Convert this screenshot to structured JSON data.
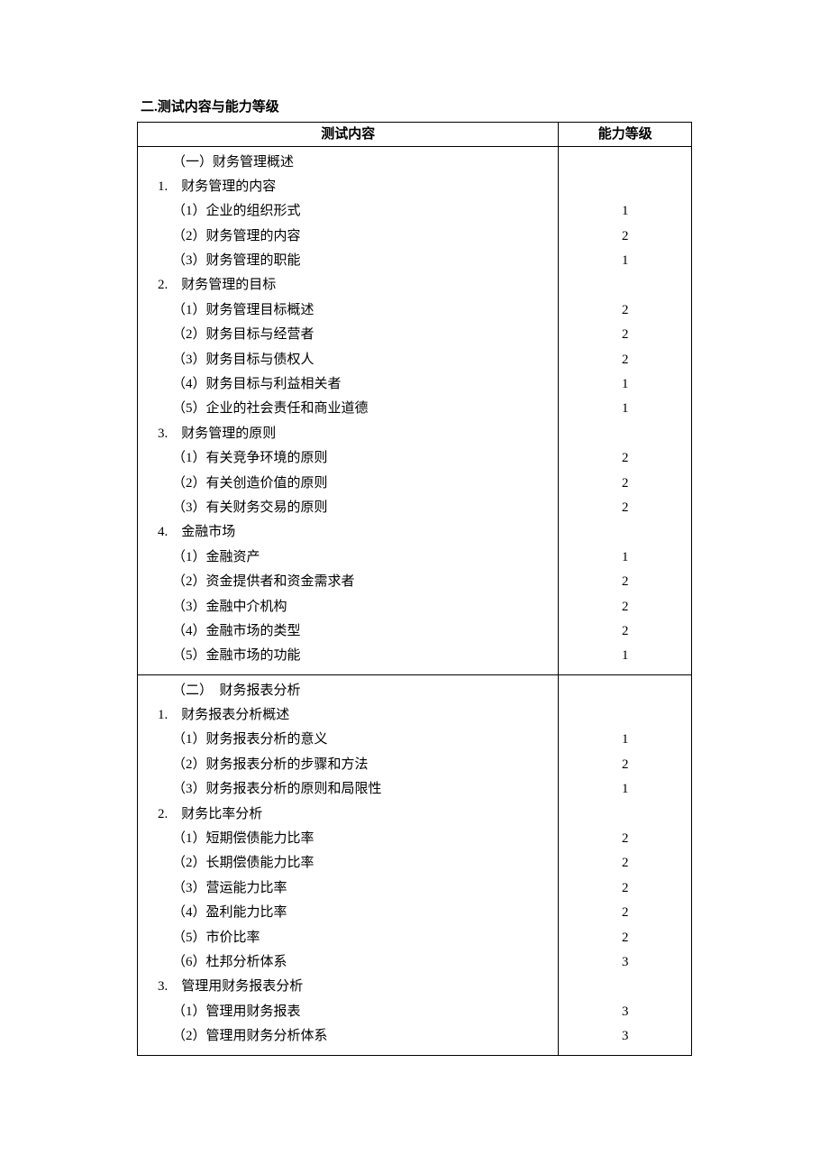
{
  "section_title": "二.测试内容与能力等级",
  "table": {
    "headers": {
      "content": "测试内容",
      "level": "能力等级"
    },
    "groups": [
      {
        "rows": [
          {
            "text": "（一）财务管理概述",
            "level": "",
            "cls": "heading-row"
          },
          {
            "text": "1.　财务管理的内容",
            "level": "",
            "cls": "num"
          },
          {
            "text": "（1）企业的组织形式",
            "level": "1",
            "cls": "sub-row"
          },
          {
            "text": "（2）财务管理的内容",
            "level": "2",
            "cls": "sub-row"
          },
          {
            "text": "（3）财务管理的职能",
            "level": "1",
            "cls": "sub-row"
          },
          {
            "text": "2.　财务管理的目标",
            "level": "",
            "cls": "num"
          },
          {
            "text": "（1）财务管理目标概述",
            "level": "2",
            "cls": "sub-row"
          },
          {
            "text": "（2）财务目标与经营者",
            "level": "2",
            "cls": "sub-row"
          },
          {
            "text": "（3）财务目标与债权人",
            "level": "2",
            "cls": "sub-row"
          },
          {
            "text": "（4）财务目标与利益相关者",
            "level": "1",
            "cls": "sub-row"
          },
          {
            "text": "（5）企业的社会责任和商业道德",
            "level": "1",
            "cls": "sub-row"
          },
          {
            "text": "3.　财务管理的原则",
            "level": "",
            "cls": "num"
          },
          {
            "text": "（1）有关竞争环境的原则",
            "level": "2",
            "cls": "sub-row"
          },
          {
            "text": "（2）有关创造价值的原则",
            "level": "2",
            "cls": "sub-row"
          },
          {
            "text": "（3）有关财务交易的原则",
            "level": "2",
            "cls": "sub-row"
          },
          {
            "text": "4.　金融市场",
            "level": "",
            "cls": "num"
          },
          {
            "text": "（1）金融资产",
            "level": "1",
            "cls": "sub-row"
          },
          {
            "text": "（2）资金提供者和资金需求者",
            "level": "2",
            "cls": "sub-row"
          },
          {
            "text": "（3）金融中介机构",
            "level": "2",
            "cls": "sub-row"
          },
          {
            "text": "（4）金融市场的类型",
            "level": "2",
            "cls": "sub-row"
          },
          {
            "text": "（5）金融市场的功能",
            "level": "1",
            "cls": "sub-row"
          }
        ]
      },
      {
        "rows": [
          {
            "text": "（二）　财务报表分析",
            "level": "",
            "cls": "heading-row"
          },
          {
            "text": "1.　财务报表分析概述",
            "level": "",
            "cls": "num"
          },
          {
            "text": "（1）财务报表分析的意义",
            "level": "1",
            "cls": "sub-row"
          },
          {
            "text": "（2）财务报表分析的步骤和方法",
            "level": "2",
            "cls": "sub-row"
          },
          {
            "text": "（3）财务报表分析的原则和局限性",
            "level": "1",
            "cls": "sub-row"
          },
          {
            "text": "2.　财务比率分析",
            "level": "",
            "cls": "num"
          },
          {
            "text": "（1）短期偿债能力比率",
            "level": "2",
            "cls": "sub-row"
          },
          {
            "text": "（2）长期偿债能力比率",
            "level": "2",
            "cls": "sub-row"
          },
          {
            "text": "（3）营运能力比率",
            "level": "2",
            "cls": "sub-row"
          },
          {
            "text": "（4）盈利能力比率",
            "level": "2",
            "cls": "sub-row"
          },
          {
            "text": "（5）市价比率",
            "level": "2",
            "cls": "sub-row"
          },
          {
            "text": "（6）杜邦分析体系",
            "level": "3",
            "cls": "sub-row"
          },
          {
            "text": "3.　管理用财务报表分析",
            "level": "",
            "cls": "num"
          },
          {
            "text": "（1）管理用财务报表",
            "level": "3",
            "cls": "sub-row"
          },
          {
            "text": "（2）管理用财务分析体系",
            "level": "3",
            "cls": "sub-row"
          }
        ]
      }
    ]
  }
}
